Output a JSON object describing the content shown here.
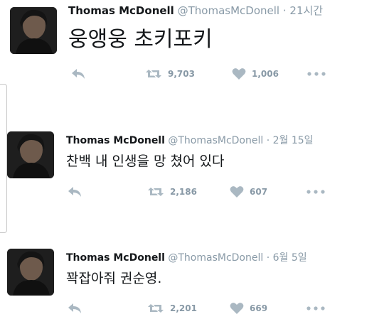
{
  "tweets": [
    {
      "name": "Thomas McDonell",
      "handle": "@ThomasMcDonell",
      "time": "21시간",
      "text": "웅앵웅 초키포키",
      "retweets": "9,703",
      "likes": "1,006"
    },
    {
      "name": "Thomas McDonell",
      "handle": "@ThomasMcDonell",
      "time": "2월 15일",
      "text": "찬백 내 인생을 망 쳤어 있다",
      "retweets": "2,186",
      "likes": "607"
    },
    {
      "name": "Thomas McDonell",
      "handle": "@ThomasMcDonell",
      "time": "6월 5일",
      "text": "꽉잡아줘 권순영.",
      "retweets": "2,201",
      "likes": "669"
    }
  ],
  "separator": "·",
  "icons": {
    "reply": "reply-icon",
    "retweet": "retweet-icon",
    "like": "heart-icon",
    "more": "more-icon"
  },
  "colors": {
    "name": "#14171a",
    "meta": "#8899a6",
    "icon": "#aab8c2"
  }
}
